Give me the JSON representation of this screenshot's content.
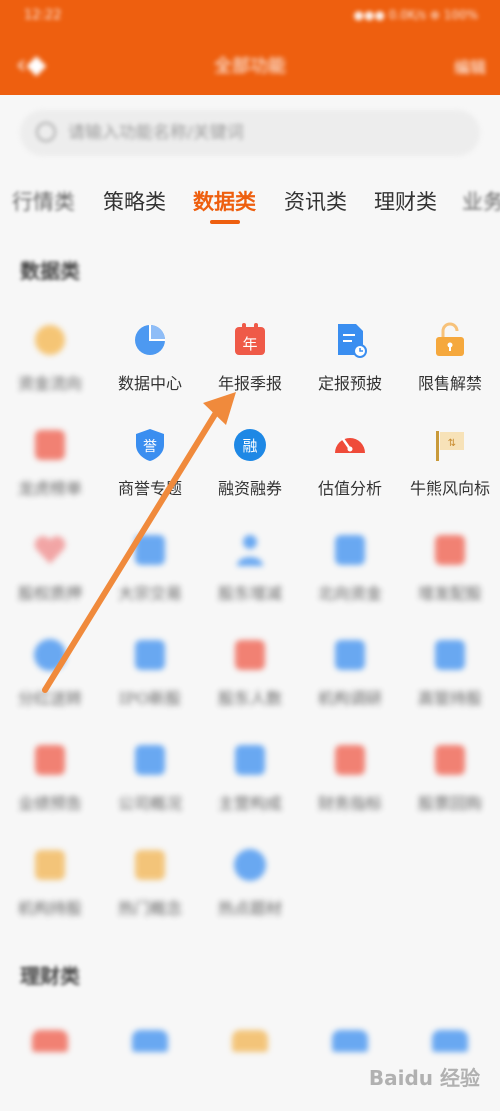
{
  "statusbar": {
    "time": "12:22",
    "right": "●●● 0.0K/s ⊕ 100%"
  },
  "header": {
    "title": "全部功能",
    "right_action": "编辑"
  },
  "search": {
    "placeholder": "请输入功能名称/关键词"
  },
  "tabs": [
    {
      "label": "行情类",
      "blur": true
    },
    {
      "label": "策略类",
      "blur": false
    },
    {
      "label": "数据类",
      "blur": false,
      "active": true
    },
    {
      "label": "资讯类",
      "blur": false
    },
    {
      "label": "理财类",
      "blur": false
    },
    {
      "label": "业务",
      "blur": true
    }
  ],
  "sections": {
    "data_title": "数据类",
    "finance_title": "理财类"
  },
  "data_grid": [
    {
      "label": "资金流向",
      "blur": true,
      "icon": "sun-icon",
      "color": "#f5b54a"
    },
    {
      "label": "数据中心",
      "blur": false,
      "icon": "pie-chart-icon",
      "color": "#3a8ef0"
    },
    {
      "label": "年报季报",
      "blur": false,
      "icon": "calendar-icon",
      "color": "#ef5a48",
      "glyph": "年"
    },
    {
      "label": "定报预披",
      "blur": false,
      "icon": "document-clock-icon",
      "color": "#3a8ef0"
    },
    {
      "label": "限售解禁",
      "blur": false,
      "icon": "unlock-icon",
      "color": "#f5a83d"
    },
    {
      "label": "龙虎榜单",
      "blur": true,
      "icon": "grid-icon",
      "color": "#ef5a48"
    },
    {
      "label": "商誉专题",
      "blur": false,
      "icon": "shield-icon",
      "color": "#3a8ef0",
      "glyph": "誉"
    },
    {
      "label": "融资融券",
      "blur": false,
      "icon": "margin-icon",
      "color": "#1e88e5",
      "glyph": "融"
    },
    {
      "label": "估值分析",
      "blur": false,
      "icon": "gauge-icon",
      "color": "#ef4b3a"
    },
    {
      "label": "牛熊风向标",
      "blur": false,
      "icon": "flag-icon",
      "color": "#f2b450"
    },
    {
      "label": "股权质押",
      "blur": true,
      "icon": "heart-icon",
      "color": "#f08a8a"
    },
    {
      "label": "大宗交易",
      "blur": true,
      "icon": "box-icon",
      "color": "#3a8ef0"
    },
    {
      "label": "股东增减",
      "blur": true,
      "icon": "person-icon",
      "color": "#3a8ef0"
    },
    {
      "label": "北向资金",
      "blur": true,
      "icon": "chart-icon",
      "color": "#3a8ef0"
    },
    {
      "label": "增发配股",
      "blur": true,
      "icon": "square-icon",
      "color": "#ef5a48"
    },
    {
      "label": "分红送转",
      "blur": true,
      "icon": "globe-icon",
      "color": "#3a8ef0"
    },
    {
      "label": "IPO新股",
      "blur": true,
      "icon": "ticket-icon",
      "color": "#3a8ef0"
    },
    {
      "label": "股东人数",
      "blur": true,
      "icon": "people-icon",
      "color": "#ef5a48"
    },
    {
      "label": "机构调研",
      "blur": true,
      "icon": "mail-icon",
      "color": "#3a8ef0"
    },
    {
      "label": "高管持股",
      "blur": true,
      "icon": "chat-icon",
      "color": "#3a8ef0"
    },
    {
      "lable_skip": "",
      "label": "业绩预告",
      "blur": true,
      "icon": "bag-icon",
      "color": "#ef5a48"
    },
    {
      "label": "公司概况",
      "blur": true,
      "icon": "table-icon",
      "color": "#3a8ef0"
    },
    {
      "label": "主营构成",
      "blur": true,
      "icon": "monitor-icon",
      "color": "#3a8ef0"
    },
    {
      "label": "财务指标",
      "blur": true,
      "icon": "trend-icon",
      "color": "#ef5a48"
    },
    {
      "label": "股票回购",
      "blur": true,
      "icon": "speech-icon",
      "color": "#ef5a48"
    },
    {
      "label": "机构持股",
      "blur": true,
      "icon": "crown-icon",
      "color": "#f2b450"
    },
    {
      "label": "热门概念",
      "blur": true,
      "icon": "crown2-icon",
      "color": "#f2b450"
    },
    {
      "label": "热点题材",
      "blur": true,
      "icon": "circle-icon",
      "color": "#3a8ef0"
    }
  ],
  "finance_grid": [
    {
      "icon": "coin-icon",
      "color": "#ef5a48"
    },
    {
      "icon": "card-icon",
      "color": "#3a8ef0"
    },
    {
      "icon": "bag2-icon",
      "color": "#f2b450"
    },
    {
      "icon": "wallet-icon",
      "color": "#3a8ef0"
    },
    {
      "icon": "cloud-icon",
      "color": "#3a8ef0"
    }
  ],
  "watermark": "Baidu 经验",
  "colors": {
    "brand": "#ee5f0f",
    "arrow": "#f08a3c"
  }
}
